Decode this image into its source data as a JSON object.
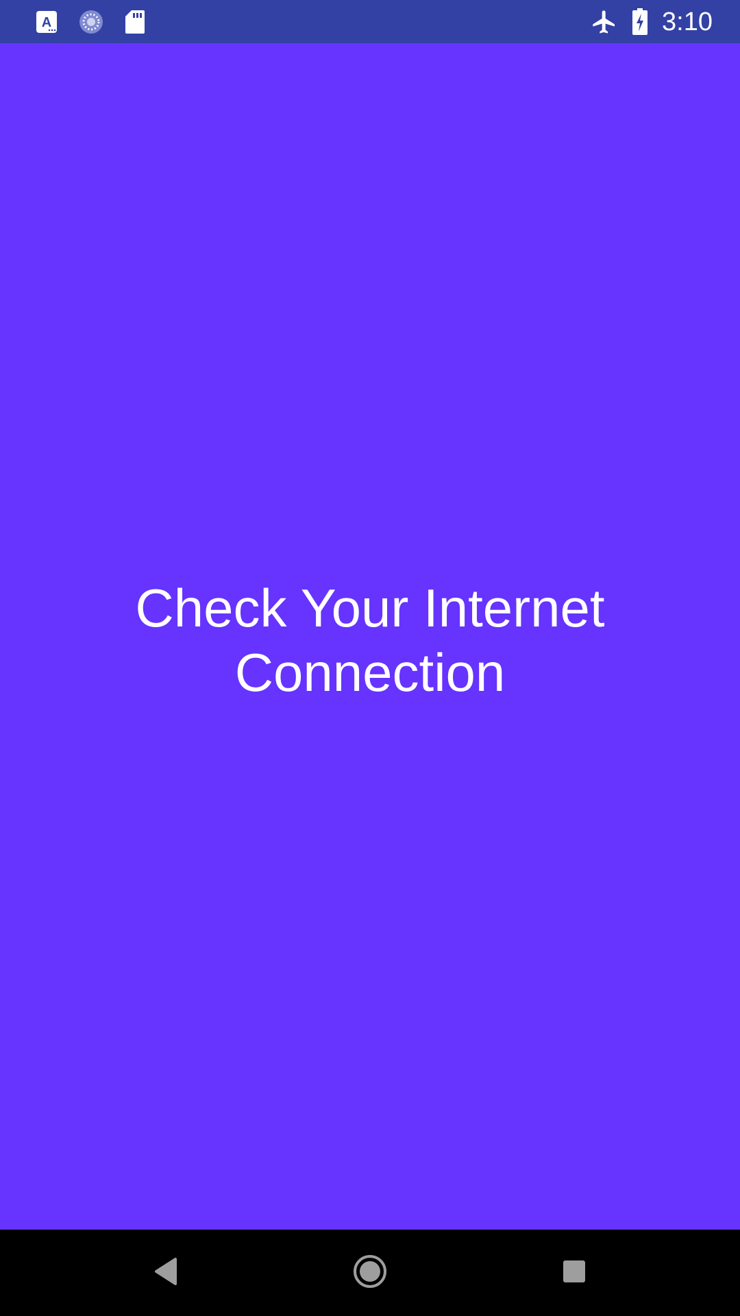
{
  "status_bar": {
    "time": "3:10",
    "background": "#3341a4",
    "left_icons": [
      "accessibility-a-icon",
      "sync-spinner-icon",
      "sd-card-icon"
    ],
    "right_icons": [
      "airplane-mode-icon",
      "battery-charging-icon"
    ]
  },
  "main": {
    "background": "#6633ff",
    "message_line1": "Check Your Internet",
    "message_line2": "Connection"
  },
  "nav_bar": {
    "buttons": [
      "back-icon",
      "home-icon",
      "recents-icon"
    ]
  }
}
